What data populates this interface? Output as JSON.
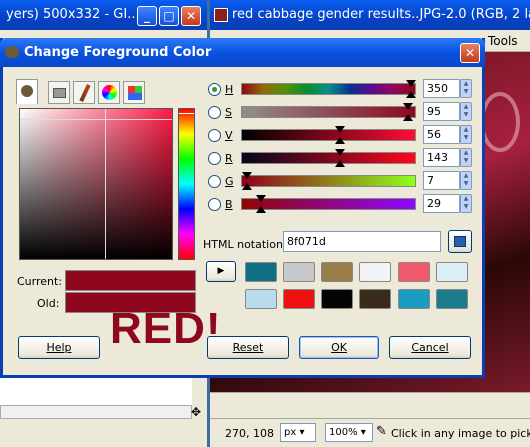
{
  "bg_left": {
    "title": "yers) 500x332 - GI..."
  },
  "bg_right": {
    "title": "red cabbage gender results..JPG-2.0 (RGB, 2 lay",
    "menu_item": "Tools",
    "status_coords": "270, 108",
    "unit": "px",
    "zoom": "100%",
    "hint": "Click in any image to pick the"
  },
  "dialog": {
    "title": "Change Foreground Color",
    "channels": [
      {
        "letter": "H",
        "value": "350"
      },
      {
        "letter": "S",
        "value": "95"
      },
      {
        "letter": "V",
        "value": "56"
      },
      {
        "letter": "R",
        "value": "143"
      },
      {
        "letter": "G",
        "value": "7"
      },
      {
        "letter": "B",
        "value": "29"
      }
    ],
    "selected_channel": "H",
    "html_label": "HTML notation:",
    "html_value": "8f071d",
    "current_label": "Current:",
    "old_label": "Old:",
    "current_color": "#8f071d",
    "old_color": "#8f071d",
    "overlay_text": "RED!",
    "swatches": [
      "#0f6f84",
      "#c8c8c8",
      "#9a7e4a",
      "#f2f4f4",
      "#ef5a6a",
      "#daf0f6",
      "#b8dcee",
      "#ee1111",
      "#050505",
      "#3a2a1a",
      "#1b9dc1",
      "#1b7b8d"
    ],
    "buttons": {
      "help": "Help",
      "reset": "Reset",
      "ok": "OK",
      "cancel": "Cancel"
    }
  }
}
